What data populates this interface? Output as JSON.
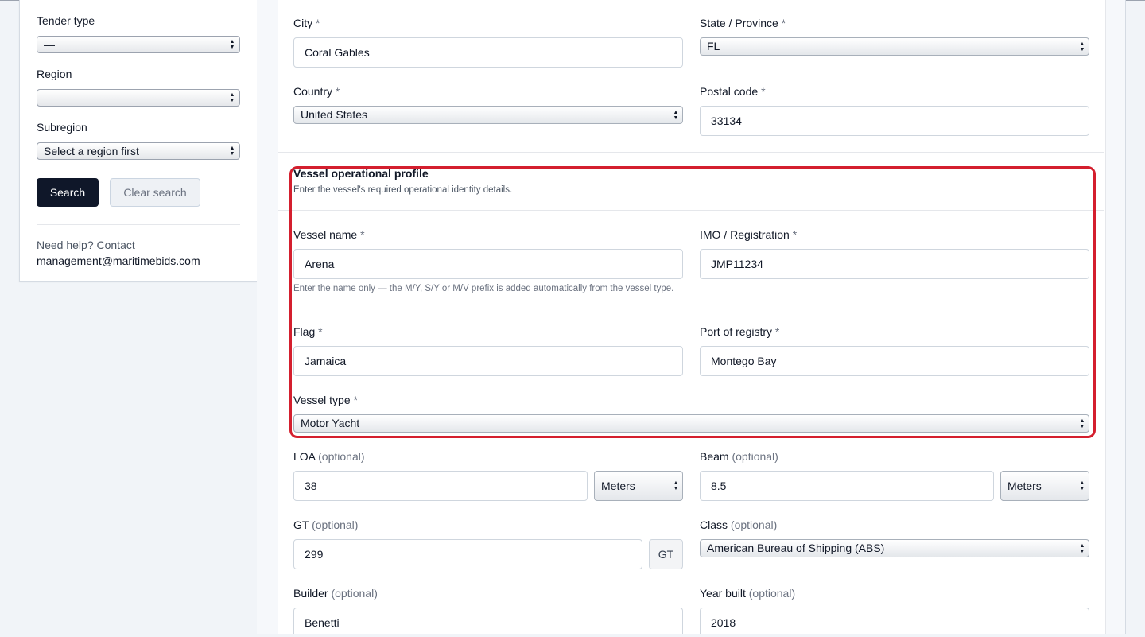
{
  "sidebar": {
    "tender_type": {
      "label": "Tender type",
      "value": "—"
    },
    "region": {
      "label": "Region",
      "value": "—"
    },
    "subregion": {
      "label": "Subregion",
      "value": "Select a region first"
    },
    "search_label": "Search",
    "clear_label": "Clear search",
    "help_text": "Need help? Contact",
    "help_email": "management@maritimebids.com"
  },
  "address": {
    "city": {
      "label": "City",
      "value": "Coral Gables"
    },
    "state": {
      "label": "State / Province",
      "value": "FL"
    },
    "country": {
      "label": "Country",
      "value": "United States"
    },
    "postal": {
      "label": "Postal code",
      "value": "33134"
    }
  },
  "vessel_profile": {
    "title": "Vessel operational profile",
    "subtitle": "Enter the vessel's required operational identity details.",
    "vessel_name": {
      "label": "Vessel name",
      "value": "Arena",
      "hint": "Enter the name only — the M/Y, S/Y or M/V prefix is added automatically from the vessel type."
    },
    "imo": {
      "label": "IMO / Registration",
      "value": "JMP11234"
    },
    "flag": {
      "label": "Flag",
      "value": "Jamaica"
    },
    "port": {
      "label": "Port of registry",
      "value": "Montego Bay"
    },
    "vessel_type": {
      "label": "Vessel type",
      "value": "Motor Yacht"
    }
  },
  "dimensions": {
    "loa": {
      "label": "LOA",
      "value": "38",
      "unit": "Meters"
    },
    "beam": {
      "label": "Beam",
      "value": "8.5",
      "unit": "Meters"
    },
    "gt": {
      "label": "GT",
      "value": "299",
      "unit": "GT"
    },
    "class": {
      "label": "Class",
      "value": "American Bureau of Shipping (ABS)"
    },
    "builder": {
      "label": "Builder",
      "value": "Benetti"
    },
    "year_built": {
      "label": "Year built",
      "value": "2018"
    }
  },
  "common": {
    "required_mark": "*",
    "optional_text": "(optional)",
    "chev_up": "▲",
    "chev_down": "▼"
  },
  "colors": {
    "primary_button": "#0f1729",
    "highlight_border": "#d41f2e",
    "page_background": "#f1f4f8"
  }
}
